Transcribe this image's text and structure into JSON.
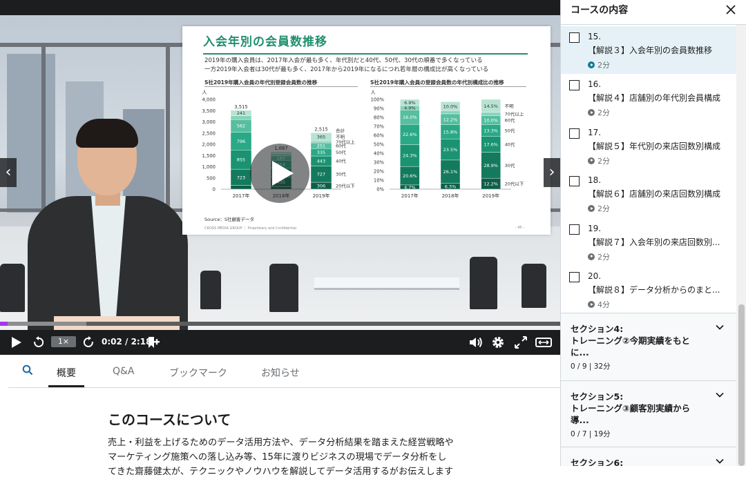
{
  "slide": {
    "title": "入会年別の会員数推移",
    "line1": "2019年の購入会員は、2017年入会が最も多く、年代別だと40代、50代、30代の順番で多くなっている",
    "line2": "一方2019年入会者は30代が最も多く、2017年から2019年になるにつれ若年層の構成比が高くなっている",
    "left_chart_title": "S社2019年購入会員の年代別登録会員数の推移",
    "right_chart_title": "S社2019年購入会員の登録会員数の年代別構成比の推移",
    "source": "Source：S社顧客データ",
    "footer": "CROSS MEDIA GROUP ｜ Proprietary and Confidential",
    "page": "- 45 -"
  },
  "chart_data": [
    {
      "type": "bar",
      "stacked": true,
      "title": "S社2019年購入会員の年代別登録会員数の推移",
      "ylabel": "人",
      "ylim": [
        0,
        4000
      ],
      "yticks": [
        "0",
        "500",
        "1,000",
        "1,500",
        "2,000",
        "2,500",
        "3,000",
        "3,500",
        "4,000"
      ],
      "categories": [
        "2017年",
        "2018年",
        "2019年"
      ],
      "totals_label": "合計",
      "totals": [
        "3,515",
        "1,667",
        "2,515"
      ],
      "series": [
        {
          "name": "20代以下",
          "values": [
            166,
            105,
            306
          ],
          "labels": [
            "166",
            "105",
            "306"
          ]
        },
        {
          "name": "30代",
          "values": [
            723,
            435,
            727
          ],
          "labels": [
            "723",
            "435",
            "727"
          ]
        },
        {
          "name": "40代",
          "values": [
            855,
            391,
            443
          ],
          "labels": [
            "855",
            "391",
            "443"
          ]
        },
        {
          "name": "50代",
          "values": [
            796,
            354,
            335
          ],
          "labels": [
            "796",
            "354",
            "335"
          ]
        },
        {
          "name": "60代",
          "values": [
            562,
            197,
            251
          ],
          "labels": [
            "562",
            "197",
            "251"
          ]
        },
        {
          "name": "70代以上",
          "values": [
            171,
            95,
            88
          ],
          "labels": [
            "171",
            "95",
            "88"
          ]
        },
        {
          "name": "不明",
          "values": [
            241,
            88,
            365
          ],
          "labels": [
            "241",
            "88",
            "365"
          ]
        }
      ]
    },
    {
      "type": "bar",
      "stacked": true,
      "title": "S社2019年購入会員の登録会員数の年代別構成比の推移",
      "ylabel": "人",
      "ylim": [
        0,
        100
      ],
      "yticks": [
        "0%",
        "10%",
        "20%",
        "30%",
        "40%",
        "50%",
        "60%",
        "70%",
        "80%",
        "90%",
        "100%"
      ],
      "categories": [
        "2017年",
        "2018年",
        "2019年"
      ],
      "series": [
        {
          "name": "20代以下",
          "values": [
            4.7,
            6.3,
            12.2
          ],
          "labels": [
            "4.7%",
            "6.3%",
            "12.2%"
          ]
        },
        {
          "name": "30代",
          "values": [
            20.6,
            26.1,
            28.9
          ],
          "labels": [
            "20.6%",
            "26.1%",
            "28.9%"
          ]
        },
        {
          "name": "40代",
          "values": [
            24.3,
            23.5,
            17.6
          ],
          "labels": [
            "24.3%",
            "23.5%",
            "17.6%"
          ]
        },
        {
          "name": "50代",
          "values": [
            22.6,
            15.8,
            13.3
          ],
          "labels": [
            "22.6%",
            "15.8%",
            "13.3%"
          ]
        },
        {
          "name": "60代",
          "values": [
            16.0,
            12.2,
            10.0
          ],
          "labels": [
            "16.0%",
            "12.2%",
            "10.0%"
          ]
        },
        {
          "name": "70代以上",
          "values": [
            4.9,
            3.5,
            3.5
          ],
          "labels": [
            "4.9%",
            "3.5%",
            "3.5%"
          ]
        },
        {
          "name": "不明",
          "values": [
            6.9,
            10.0,
            14.5
          ],
          "labels": [
            "6.9%",
            "10.0%",
            "14.5%"
          ]
        }
      ],
      "colors": [
        "#0e5f49",
        "#137a5d",
        "#1a9371",
        "#2aa987",
        "#55bf9f",
        "#8ad3bb",
        "#b7e3d3"
      ]
    }
  ],
  "player": {
    "speed": "1×",
    "time": "0:02 / 2:18",
    "progress": 0.013,
    "buffered": 0.154
  },
  "tabs": [
    "概要",
    "Q&A",
    "ブックマーク",
    "お知らせ"
  ],
  "about": {
    "title": "このコースについて",
    "p1": "売上・利益を上げるためのデータ活用方法や、データ分析結果を踏まえた経営戦略や",
    "p2": "マーケティング施策への落し込み等、15年に渡りビジネスの現場でデータ分析をし",
    "p3": "てきた齋藤健太が、テクニックやノウハウを解説してデータ活用するがお伝えします"
  },
  "sidebar": {
    "title": "コースの内容",
    "lessons": [
      {
        "num": "15.",
        "title": "【解説３】入会年別の会員数推移",
        "duration": "2分"
      },
      {
        "num": "16.",
        "title": "【解説４】店舗別の年代別会員構成",
        "duration": "2分"
      },
      {
        "num": "17.",
        "title": "【解説５】年代別の来店回数別構成",
        "duration": "2分"
      },
      {
        "num": "18.",
        "title": "【解説６】店舗別の来店回数別構成",
        "duration": "2分"
      },
      {
        "num": "19.",
        "title": "【解説７】入会年別の来店回数別...",
        "duration": "2分"
      },
      {
        "num": "20.",
        "title": "【解説８】データ分析からのまと...",
        "duration": "4分"
      }
    ],
    "sections": [
      {
        "title": "セクション4:",
        "subtitle1": "トレーニング②今期実績をもと",
        "subtitle2": "に...",
        "meta": "0 / 9 | 32分"
      },
      {
        "title": "セクション5:",
        "subtitle1": "トレーニング③顧客別実績から",
        "subtitle2": "導...",
        "meta": "0 / 7 | 19分"
      },
      {
        "title": "セクション6:",
        "subtitle1": "",
        "subtitle2": "",
        "meta": ""
      }
    ]
  },
  "icons": {
    "play": "play-icon",
    "rewind": "rewind-icon",
    "forward": "forward-icon",
    "bookmark-add": "bookmark-add-icon",
    "volume": "volume-icon",
    "settings": "gear-icon",
    "fullscreen": "fullscreen-icon",
    "theater": "expand-icon",
    "search": "search-icon",
    "close": "close-icon",
    "chevron": "chevron-down-icon"
  }
}
